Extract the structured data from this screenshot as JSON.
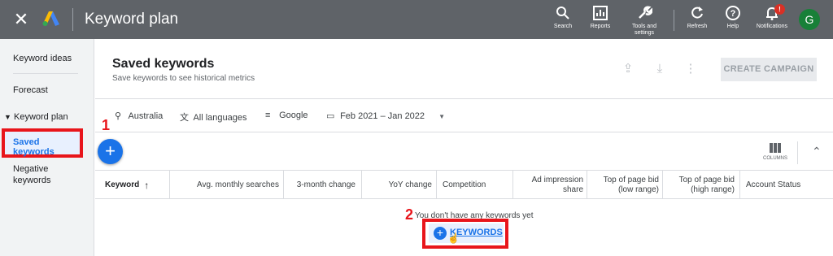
{
  "topbar": {
    "title": "Keyword plan",
    "items": [
      {
        "label": "Search",
        "icon": "search-icon"
      },
      {
        "label": "Reports",
        "icon": "reports-icon"
      },
      {
        "label": "Tools and settings",
        "icon": "wrench-icon"
      },
      {
        "label": "Refresh",
        "icon": "refresh-icon"
      },
      {
        "label": "Help",
        "icon": "help-icon"
      },
      {
        "label": "Notifications",
        "icon": "bell-icon"
      }
    ],
    "notification_count": "!",
    "avatar_letter": "G",
    "bg_color": "#5f6368"
  },
  "sidebar": {
    "items": [
      "Keyword ideas",
      "Forecast",
      "Keyword plan",
      "Saved keywords",
      "Negative keywords"
    ],
    "selected": "Saved keywords"
  },
  "header": {
    "title": "Saved keywords",
    "subtitle": "Save keywords to see historical metrics",
    "create_campaign": "CREATE CAMPAIGN"
  },
  "filters": {
    "location": "Australia",
    "language": "All languages",
    "network": "Google",
    "date_range": "Feb 2021 – Jan 2022"
  },
  "annotations": {
    "step1": "1",
    "step2": "2",
    "highlight_color": "#e8151b"
  },
  "toolbar": {
    "columns_label": "COLUMNS"
  },
  "table": {
    "columns": [
      "Keyword",
      "Avg. monthly searches",
      "3-month change",
      "YoY change",
      "Competition",
      "Ad impression share",
      "Top of page bid (low range)",
      "Top of page bid (high range)",
      "Account Status"
    ],
    "empty_message": "You don't have any keywords yet",
    "add_keywords_label": "KEYWORDS"
  },
  "colors": {
    "accent": "#1a73e8",
    "brand_logo_blue": "#4285f4",
    "brand_logo_yellow": "#fbbc04"
  }
}
